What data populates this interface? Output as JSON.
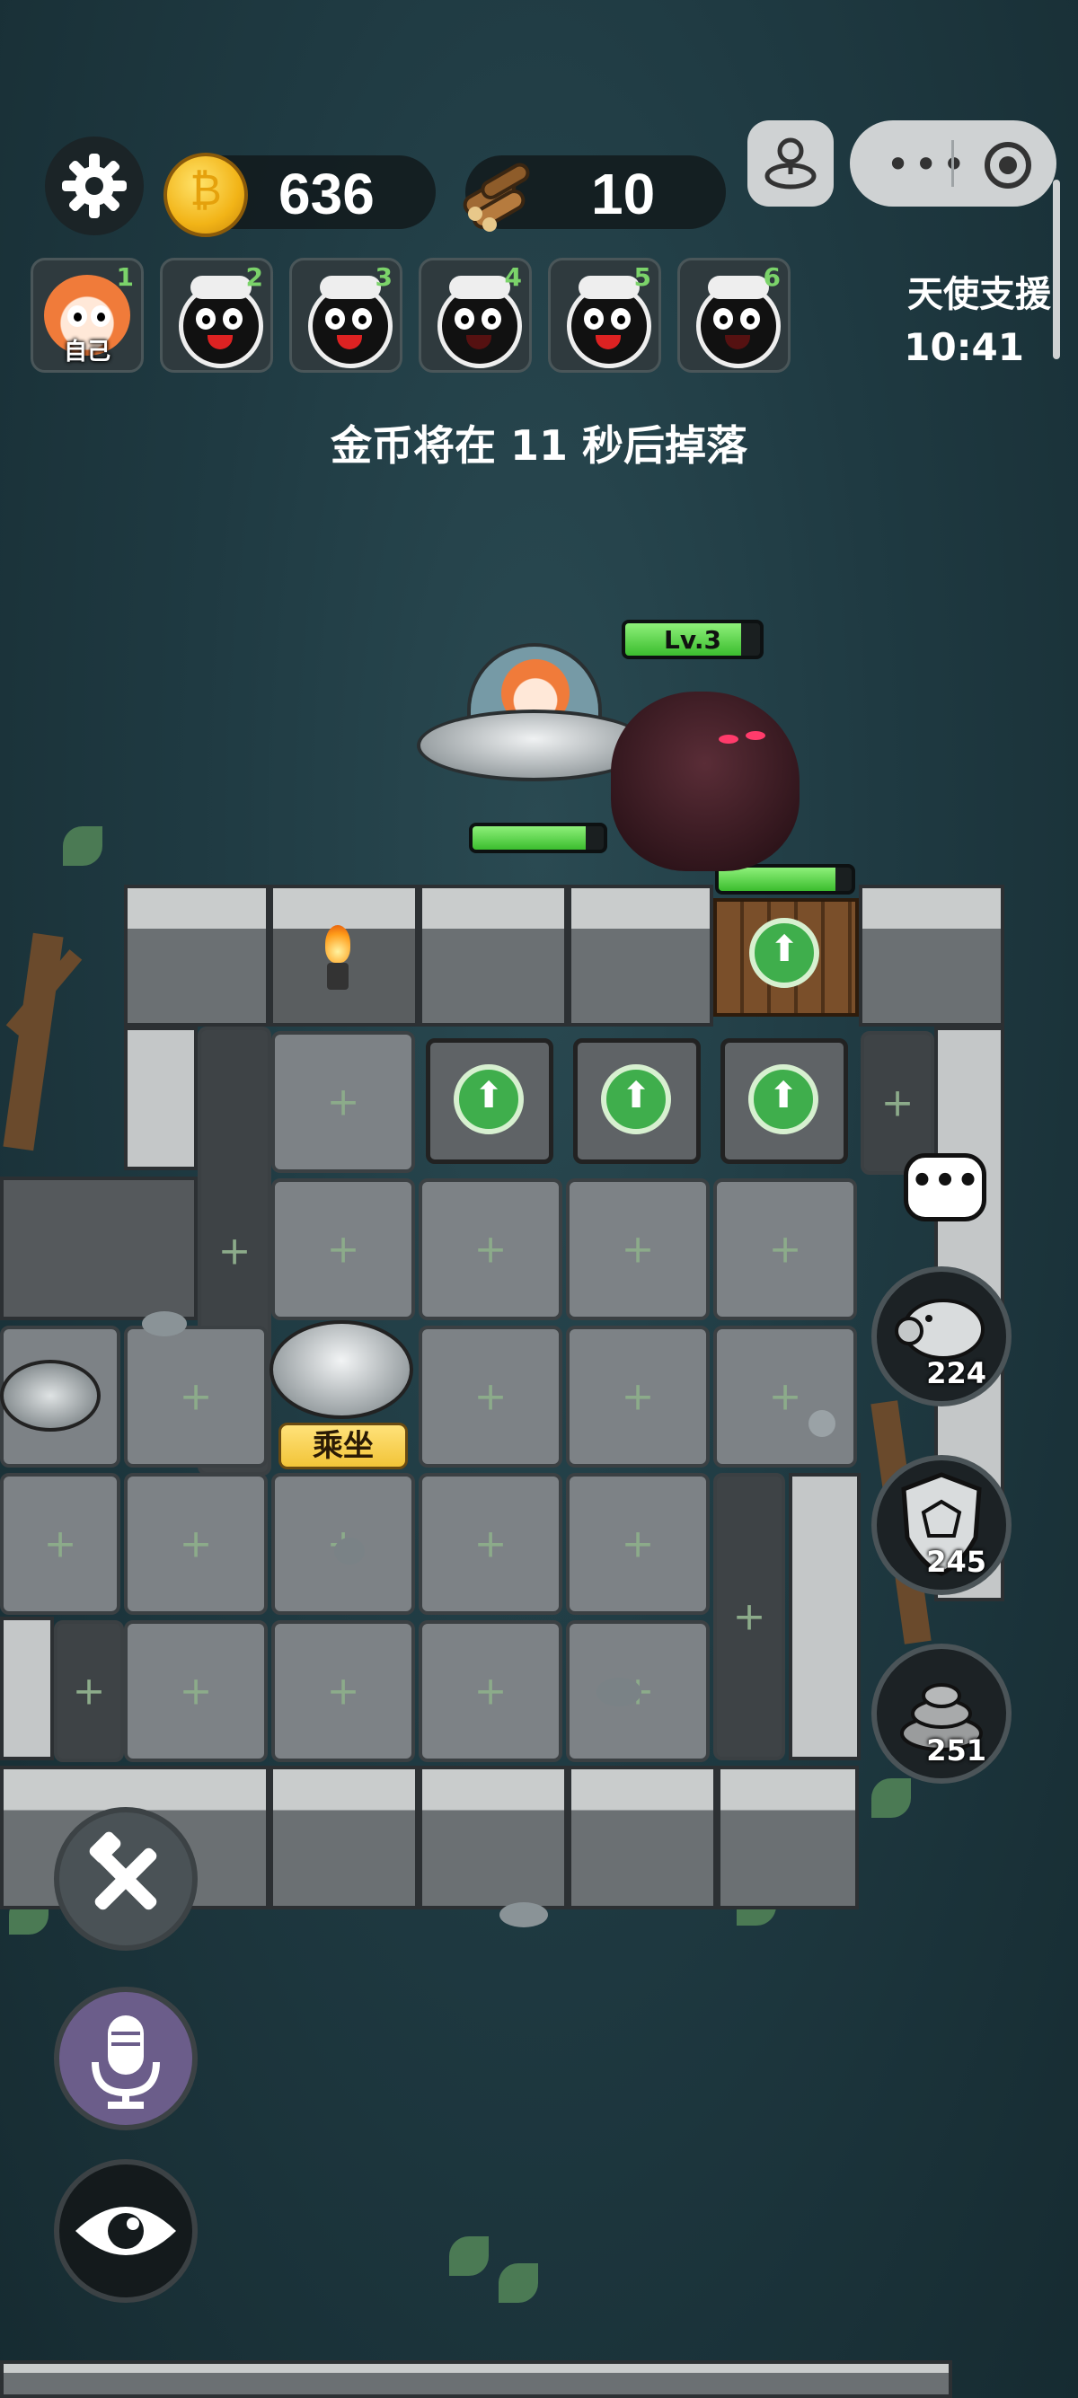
{
  "hud": {
    "coins": "636",
    "wood": "10",
    "angel_support_label": "天使支援",
    "timer": "10:41"
  },
  "players": [
    {
      "num": "1",
      "label": "自己",
      "self": true
    },
    {
      "num": "2"
    },
    {
      "num": "3"
    },
    {
      "num": "4"
    },
    {
      "num": "5"
    },
    {
      "num": "6"
    }
  ],
  "notice": "金币将在 11 秒后掉落",
  "enemy": {
    "level_label": "Lv.3",
    "health_fraction": 0.86
  },
  "player_ufo": {
    "health_fraction": 0.86
  },
  "gate": {
    "health_fraction": 0.88
  },
  "ride_button": "乘坐",
  "side_buttons": {
    "piggy_bank_count": "224",
    "shield_count": "245",
    "poop_count": "251"
  },
  "icons": [
    "gear-icon",
    "coin-icon",
    "wood-icon",
    "mini-program-icon",
    "more-icon",
    "close-icon",
    "chat-icon",
    "piggy-bank-icon",
    "shield-icon",
    "poop-icon",
    "tools-icon",
    "microphone-icon",
    "eye-icon",
    "torch-icon",
    "upgrade-arrow-icon"
  ],
  "colors": {
    "background": "#1f3a42",
    "health_green": "#3bbd2e",
    "upgrade_green": "#3fae4c",
    "ride_button_yellow": "#f2c438"
  }
}
